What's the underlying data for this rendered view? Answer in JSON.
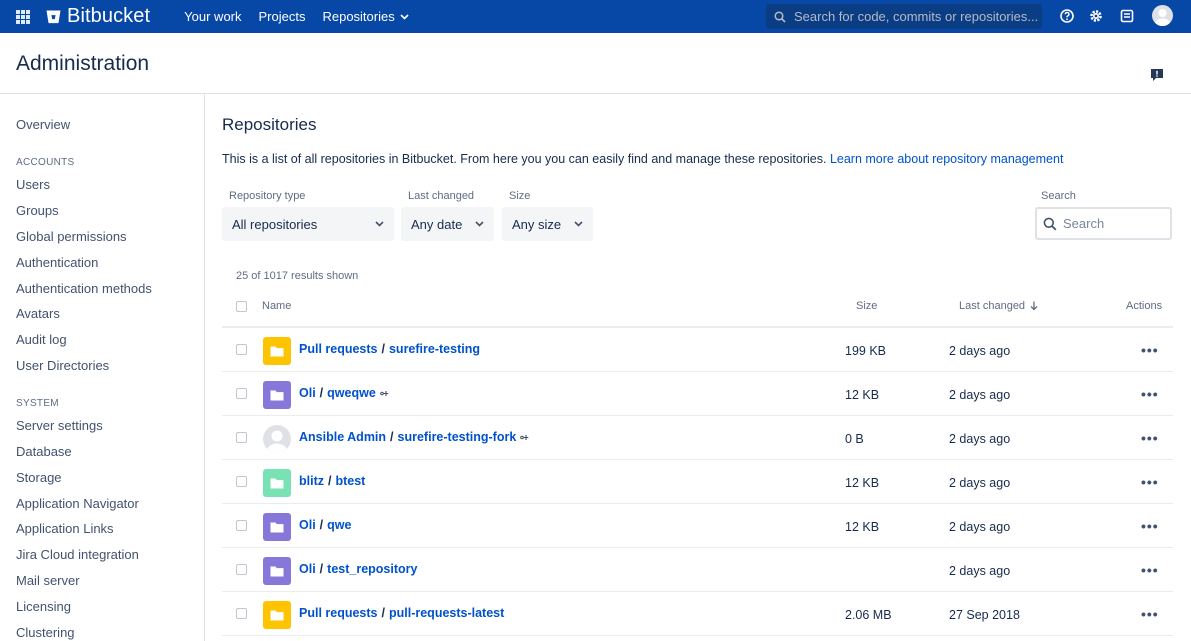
{
  "topbar": {
    "brand": "Bitbucket",
    "nav": [
      "Your work",
      "Projects",
      "Repositories"
    ],
    "search_placeholder": "Search for code, commits or repositories...",
    "bg_color": "#0747a6"
  },
  "header": {
    "title": "Administration"
  },
  "sidebar": {
    "overview": "Overview",
    "accounts_heading": "ACCOUNTS",
    "accounts": [
      "Users",
      "Groups",
      "Global permissions",
      "Authentication",
      "Authentication methods",
      "Avatars",
      "Audit log",
      "User Directories"
    ],
    "system_heading": "SYSTEM",
    "system": [
      "Server settings",
      "Database",
      "Storage",
      "Application Navigator",
      "Application Links",
      "Jira Cloud integration",
      "Mail server",
      "Licensing",
      "Clustering"
    ]
  },
  "main": {
    "title": "Repositories",
    "description": "This is a list of all repositories in Bitbucket. From here you you can easily find and manage these repositories.",
    "learn_more": "Learn more about repository management",
    "filters": {
      "type_label": "Repository type",
      "type_value": "All repositories",
      "changed_label": "Last changed",
      "changed_value": "Any date",
      "size_label": "Size",
      "size_value": "Any size",
      "search_label": "Search",
      "search_placeholder": "Search"
    },
    "results_count": "25 of 1017 results shown",
    "columns": {
      "name": "Name",
      "size": "Size",
      "last_changed": "Last changed",
      "actions": "Actions"
    },
    "rows": [
      {
        "project": "Pull requests",
        "repo": "surefire-testing",
        "size": "199 KB",
        "changed": "2 days ago",
        "icon": "folder",
        "color": "#ffc400",
        "fork": false
      },
      {
        "project": "Oli",
        "repo": "qweqwe",
        "size": "12 KB",
        "changed": "2 days ago",
        "icon": "folder",
        "color": "#8777d9",
        "fork": true
      },
      {
        "project": "Ansible Admin",
        "repo": "surefire-testing-fork",
        "size": "0 B",
        "changed": "2 days ago",
        "icon": "avatar",
        "color": "#dfe1e6",
        "fork": true
      },
      {
        "project": "blitz",
        "repo": "btest",
        "size": "12 KB",
        "changed": "2 days ago",
        "icon": "folder",
        "color": "#79e2b4",
        "fork": false
      },
      {
        "project": "Oli",
        "repo": "qwe",
        "size": "12 KB",
        "changed": "2 days ago",
        "icon": "folder",
        "color": "#8777d9",
        "fork": false
      },
      {
        "project": "Oli",
        "repo": "test_repository",
        "size": "",
        "changed": "2 days ago",
        "icon": "folder",
        "color": "#8777d9",
        "fork": false
      },
      {
        "project": "Pull requests",
        "repo": "pull-requests-latest",
        "size": "2.06 MB",
        "changed": "27 Sep 2018",
        "icon": "folder",
        "color": "#ffc400",
        "fork": false
      }
    ],
    "actions_glyph": "•••"
  }
}
